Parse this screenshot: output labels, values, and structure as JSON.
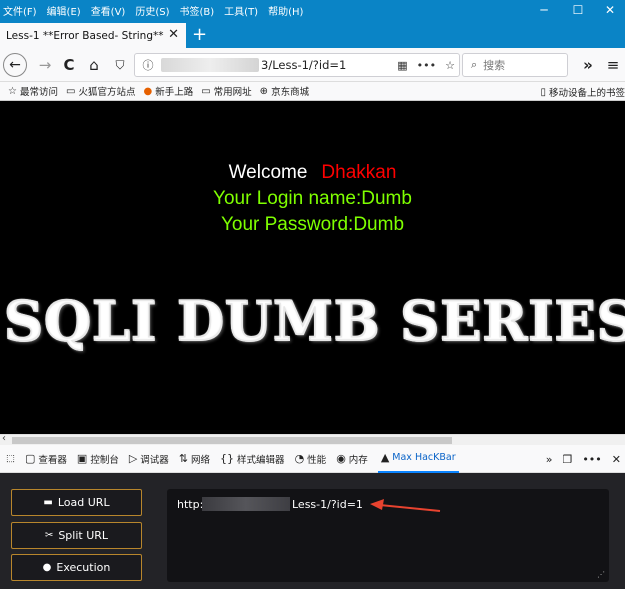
{
  "menu": [
    "文件(F)",
    "编辑(E)",
    "查看(V)",
    "历史(S)",
    "书签(B)",
    "工具(T)",
    "帮助(H)"
  ],
  "window_controls": {
    "minimize": "─",
    "maximize": "☐",
    "close": "✕"
  },
  "tab": {
    "title": "Less-1 **Error Based- String**",
    "close": "✕",
    "new_tab": "+"
  },
  "nav": {
    "back": "←",
    "forward": "→",
    "reload": "C",
    "home": "⌂"
  },
  "url": {
    "text": "3/Less-1/?id=1",
    "qr": "▦",
    "more": "•••",
    "star": "☆"
  },
  "search": {
    "placeholder": "搜索",
    "icon": "🔍"
  },
  "toolbar_right": {
    "overflow": "»",
    "menu": "≡"
  },
  "bookmarks": [
    {
      "label": "最常访问",
      "icon": "☆"
    },
    {
      "label": "火狐官方站点",
      "icon": "▭"
    },
    {
      "label": "新手上路",
      "icon": "●"
    },
    {
      "label": "常用网址",
      "icon": "▭"
    },
    {
      "label": "京东商城",
      "icon": "⊕"
    }
  ],
  "bookmarks_right": "移动设备上的书签",
  "content": {
    "welcome": "Welcome",
    "user": "Dhakkan",
    "login_line": "Your Login name:Dumb",
    "password_line": "Your Password:Dumb",
    "banner": "SQLI DUMB SERIES"
  },
  "devtools": {
    "tabs": [
      {
        "label": "查看器",
        "icon": "▢"
      },
      {
        "label": "控制台",
        "icon": "▣"
      },
      {
        "label": "调试器",
        "icon": "▷"
      },
      {
        "label": "网络",
        "icon": "⇅"
      },
      {
        "label": "样式编辑器",
        "icon": "{}"
      },
      {
        "label": "性能",
        "icon": "◔"
      },
      {
        "label": "内存",
        "icon": "◉"
      },
      {
        "label": "Max HacKBar",
        "icon": "▲",
        "active": true
      }
    ],
    "pick_icon": "⬚",
    "more": "»",
    "dock": "❐",
    "options": "•••",
    "close": "✕"
  },
  "hackbar": {
    "load_url": "Load URL",
    "split_url": "Split URL",
    "execution": "Execution",
    "url_prefix": "http:",
    "url_suffix": "Less-1/?id=1"
  },
  "colors": {
    "accent": "#0a84c6",
    "welcome": "#ffffff",
    "user": "#ff0000",
    "login": "#7fff00",
    "arrow": "#e8432f"
  }
}
